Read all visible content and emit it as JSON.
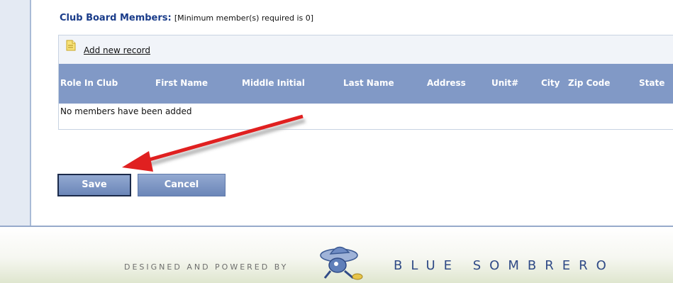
{
  "section": {
    "title": "Club Board Members:",
    "min_note": "[Minimum member(s) required is 0]"
  },
  "grid": {
    "add_record_label": "Add new record",
    "columns": [
      "Role In Club",
      "First Name",
      "Middle Initial",
      "Last Name",
      "Address",
      "Unit#",
      "City",
      "Zip Code",
      "State"
    ],
    "empty_message": "No members have been added"
  },
  "buttons": {
    "save": "Save",
    "cancel": "Cancel"
  },
  "footer": {
    "designed_by": "DESIGNED AND POWERED BY",
    "brand": "BLUE SOMBRERO"
  },
  "colors": {
    "header_blue": "#8199c6",
    "title_blue": "#1a3c8a",
    "arrow_red": "#e02020"
  },
  "icons": [
    "add-record-icon",
    "blue-sombrero-logo",
    "pointer-arrow"
  ]
}
